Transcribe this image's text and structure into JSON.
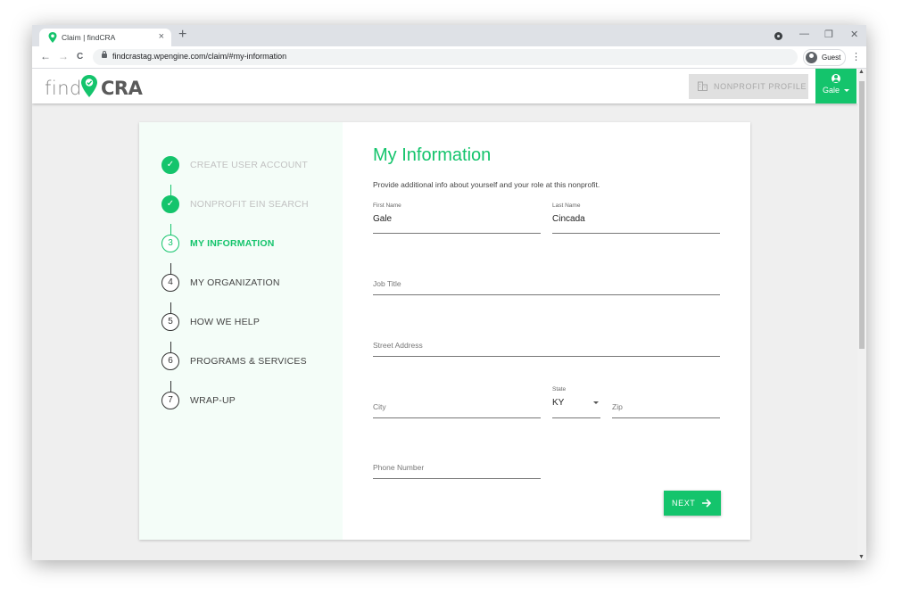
{
  "browser": {
    "tab_title": "Claim | findCRA",
    "tab_close": "×",
    "new_tab": "+",
    "url": "findcrastag.wpengine.com/claim/#my-information",
    "profile_label": "Guest",
    "back": "←",
    "forward": "→",
    "reload": "C",
    "menu": "⋮",
    "minimize": "—",
    "restore": "❐",
    "close": "✕"
  },
  "header": {
    "logo_find": "find",
    "logo_cra": "CRA",
    "nonprofit_profile": "NONPROFIT PROFILE",
    "user_name": "Gale"
  },
  "steps": [
    {
      "number": "✓",
      "label": "CREATE USER ACCOUNT",
      "state": "done"
    },
    {
      "number": "✓",
      "label": "NONPROFIT EIN SEARCH",
      "state": "done"
    },
    {
      "number": "3",
      "label": "MY INFORMATION",
      "state": "active"
    },
    {
      "number": "4",
      "label": "MY ORGANIZATION",
      "state": "pending"
    },
    {
      "number": "5",
      "label": "HOW WE HELP",
      "state": "pending"
    },
    {
      "number": "6",
      "label": "PROGRAMS & SERVICES",
      "state": "pending"
    },
    {
      "number": "7",
      "label": "WRAP-UP",
      "state": "pending"
    }
  ],
  "form": {
    "title": "My Information",
    "subtitle": "Provide additional info about yourself and your role at this nonprofit.",
    "first_name": {
      "label": "First Name",
      "value": "Gale"
    },
    "last_name": {
      "label": "Last Name",
      "value": "Cincada"
    },
    "job_title": {
      "placeholder": "Job Title"
    },
    "street": {
      "placeholder": "Street Address"
    },
    "city": {
      "placeholder": "City"
    },
    "state": {
      "label": "State",
      "value": "KY"
    },
    "zip": {
      "placeholder": "Zip"
    },
    "phone": {
      "placeholder": "Phone Number"
    },
    "next": "NEXT"
  },
  "colors": {
    "accent": "#14c46c",
    "stepper_bg": "#f4fdf8",
    "page_bg": "#efefef"
  }
}
